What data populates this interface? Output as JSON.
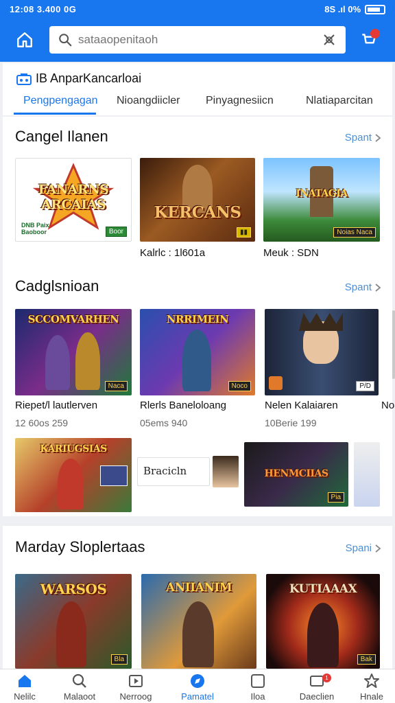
{
  "status_bar": {
    "left": "12:08 3.400 0G",
    "right": "8S .ıl 0%"
  },
  "header": {
    "search_placeholder": "sataaopenitaoh"
  },
  "brand": {
    "title": "IB AnparKancarloai"
  },
  "tabs": [
    "Pengpengagan",
    "Nioangdiicler",
    "Pinyagnesiicn",
    "Nlatiaparcitan"
  ],
  "sections": {
    "s1": {
      "title": "Cangel Ilanen",
      "more": "Spant",
      "tiles": [
        {
          "logo": "FANARNS ARCAIAS",
          "tag": "DNB Paix Baoboor",
          "chip": "Boor"
        },
        {
          "logo": "KERCANS",
          "caption": "Kalrlc : 1l601a"
        },
        {
          "logo": "INATAGIA",
          "chip": "Noias Naca",
          "caption": "Meuk : SDN"
        }
      ]
    },
    "s2": {
      "title": "Cadglsnioan",
      "more": "Spant",
      "tiles": [
        {
          "logo": "SCCOMVARHEN",
          "chip": "Naca",
          "caption": "Riepet/l lautlerven",
          "sub": "12 60os 259"
        },
        {
          "logo": "NRRIMEIN",
          "chip": "Noco",
          "caption": "Rlerls Baneloloang",
          "sub": "05ems 940"
        },
        {
          "caption": "Nelen Kalaiaren",
          "sub": "10Berie 199",
          "chip": "P/D"
        }
      ],
      "row2": [
        {
          "logo": "KARIUGSIAS"
        },
        {
          "label": "Bracicln"
        },
        {
          "logo": "HENMCIIAS",
          "chip": "Pia"
        }
      ],
      "edge_caption": "No"
    },
    "s3": {
      "title": "Marday Sloplertaas",
      "more": "Spani",
      "tiles": [
        {
          "logo": "WARSOS",
          "chip": "Bla"
        },
        {
          "logo": "ANIIANIM"
        },
        {
          "logo": "KUTIAAAX",
          "chip": "Bak"
        }
      ]
    }
  },
  "bottom_nav": [
    {
      "label": "Nelilc",
      "icon": "home-icon",
      "active": false
    },
    {
      "label": "Malaoot",
      "icon": "search-icon",
      "active": false
    },
    {
      "label": "Nerroog",
      "icon": "play-icon",
      "active": false
    },
    {
      "label": "Pamatel",
      "icon": "compass-icon",
      "active": true
    },
    {
      "label": "Iloa",
      "icon": "square-icon",
      "active": false
    },
    {
      "label": "Daeclien",
      "icon": "notification-icon",
      "active": false,
      "badge": "1"
    },
    {
      "label": "Hnale",
      "icon": "star-icon",
      "active": false
    }
  ],
  "colors": {
    "brand_blue": "#1877ee",
    "link_blue": "#4a8fd4",
    "badge_red": "#e53935"
  }
}
